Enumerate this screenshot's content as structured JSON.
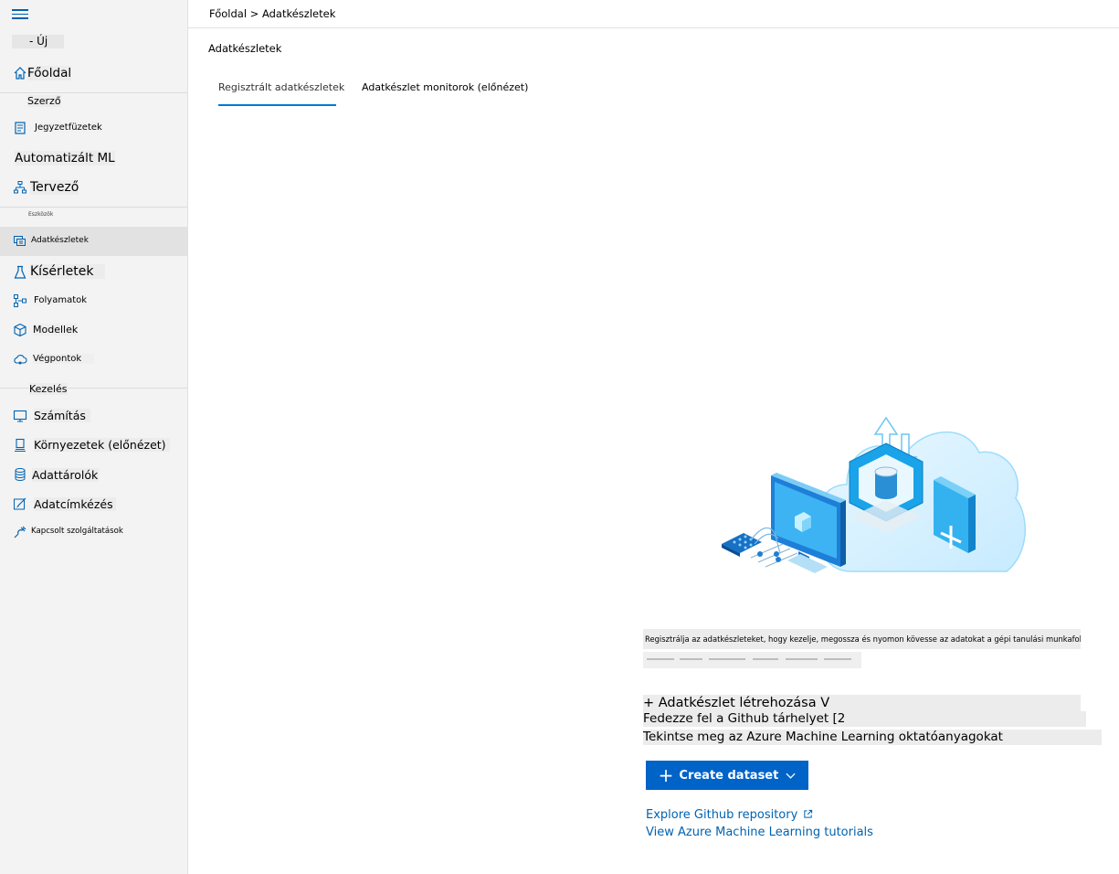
{
  "sidebar": {
    "new_label": "- Új",
    "home": "Főoldal",
    "section_author": "Szerző",
    "notebooks": "Jegyzetfüzetek",
    "automl": "Automatizált ML",
    "designer": "Tervező",
    "section_assets": "Eszközök",
    "datasets": "Adatkészletek",
    "experiments": "Kísérletek",
    "pipelines": "Folyamatok",
    "models": "Modellek",
    "endpoints": "Végpontok",
    "section_manage": "Kezelés",
    "compute": "Számítás",
    "environments": "Környezetek (előnézet)",
    "datastores": "Adattárolók",
    "data_labeling": "Adatcímkézés",
    "linked_services": "Kapcsolt szolgáltatások"
  },
  "header": {
    "breadcrumb": "Főoldal > Adatkészletek"
  },
  "main": {
    "title": "Adatkészletek",
    "tabs": [
      {
        "label": "Regisztrált adatkészletek"
      },
      {
        "label": "Adatkészlet monitorok (előnézet)"
      }
    ],
    "description": "Regisztrálja az adatkészleteket, hogy kezelje, megossza és nyomon kövesse az adatokat a gépi tanulási munkafolyamataiban.",
    "create_translated": "+ Adatkészlet létrehozása V",
    "github_translated": "Fedezze fel a Github tárhelyet [2",
    "tutorials_translated": "Tekintse meg az Azure Machine Learning oktatóanyagokat",
    "create_button": "Create dataset",
    "link_github": "Explore Github repository",
    "link_tutorials": "View Azure Machine Learning tutorials"
  },
  "colors": {
    "accent": "#0078d4",
    "button": "#0063c8",
    "link": "#0063b1"
  }
}
